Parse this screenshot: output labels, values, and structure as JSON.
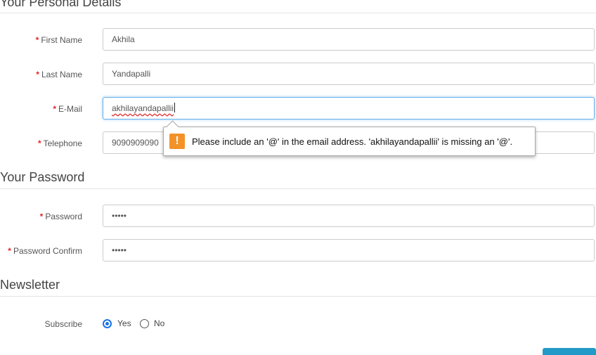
{
  "sections": {
    "personal": "Your Personal Details",
    "password": "Your Password",
    "newsletter": "Newsletter"
  },
  "required_marker": "*",
  "fields": {
    "first_name": {
      "label": "First Name",
      "value": "Akhila"
    },
    "last_name": {
      "label": "Last Name",
      "value": "Yandapalli"
    },
    "email": {
      "label": "E-Mail",
      "value": "akhilayandapallii"
    },
    "telephone": {
      "label": "Telephone",
      "value": "9090909090"
    },
    "password": {
      "label": "Password",
      "value": "•••••"
    },
    "password_confirm": {
      "label": "Password Confirm",
      "value": "•••••"
    }
  },
  "validation": {
    "icon": "warning-icon",
    "icon_glyph": "!",
    "message": "Please include an '@' in the email address. 'akhilayandapallii' is missing an '@'."
  },
  "newsletter": {
    "label": "Subscribe",
    "options": [
      {
        "label": "Yes",
        "checked": true
      },
      {
        "label": "No",
        "checked": false
      }
    ]
  },
  "colors": {
    "required": "#e4262f",
    "focus_border": "#66afe9",
    "warning": "#f4922a",
    "radio_checked": "#1a73e8",
    "button": "#229ac8"
  }
}
